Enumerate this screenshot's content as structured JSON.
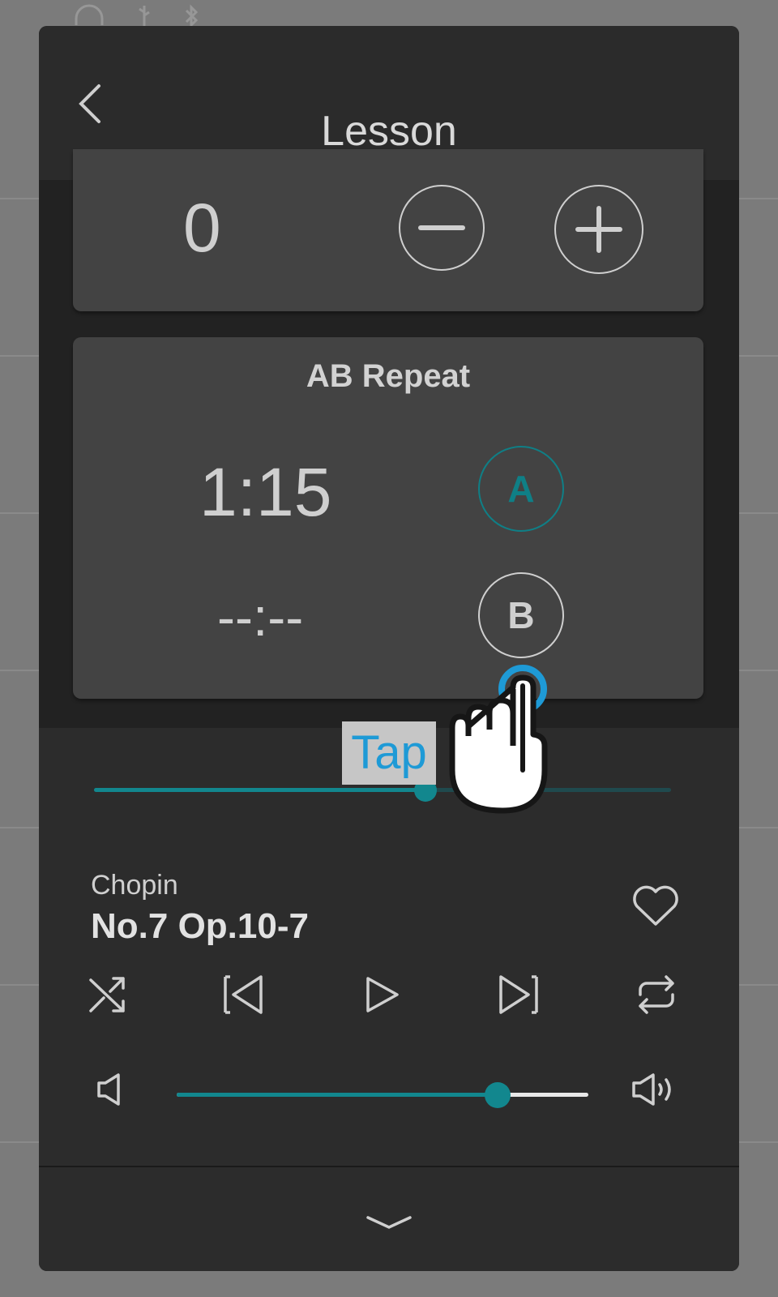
{
  "header": {
    "title": "Lesson",
    "back_icon": "chevron-left-icon"
  },
  "offset_card": {
    "value": "0",
    "minus_icon": "minus-icon",
    "plus_icon": "plus-icon"
  },
  "ab_repeat": {
    "title": "AB Repeat",
    "a_time": "1:15",
    "b_time": "--:--",
    "a_label": "A",
    "b_label": "B",
    "a_color": "#0f7f86",
    "b_color": "#cfcfcf"
  },
  "progress": {
    "position_fraction": 0.575,
    "accent": "#12878e"
  },
  "track": {
    "composer": "Chopin",
    "title": "No.7 Op.10-7",
    "favorite_icon": "heart-outline-icon"
  },
  "controls": [
    "shuffle-icon",
    "previous-icon",
    "play-icon",
    "next-icon",
    "repeat-icon"
  ],
  "volume": {
    "level_fraction": 0.78,
    "low_icon": "volume-low-icon",
    "high_icon": "volume-high-icon"
  },
  "footer": {
    "collapse_icon": "chevron-down-icon"
  },
  "hint": {
    "label": "Tap",
    "color": "#1e9ad6",
    "icon": "tap-hand-icon"
  }
}
